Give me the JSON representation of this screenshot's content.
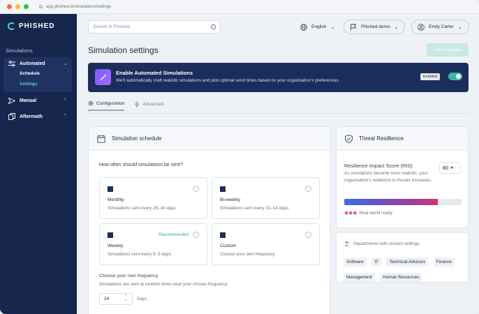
{
  "browser": {
    "url": "app.phished.io/simulations/settings"
  },
  "sidebar": {
    "brand": "PHISHED",
    "section": "Simulations",
    "items": [
      {
        "label": "Automated",
        "icon": "sliders-icon",
        "expanded": true,
        "sub": [
          "Schedule",
          "Settings"
        ],
        "active_sub": "Settings"
      },
      {
        "label": "Manual",
        "icon": "send-icon"
      },
      {
        "label": "Aftermath",
        "icon": "copy-icon"
      }
    ]
  },
  "header": {
    "search_placeholder": "Search in Phished",
    "language": "English",
    "org": "Phished demo",
    "user": "Emily Carter"
  },
  "page": {
    "title": "Simulation settings",
    "save_label": "Save changes"
  },
  "banner": {
    "title": "Enable Automated Simulations",
    "description": "We'll automatically craft realistic simulations and pick optimal send times based on your organisation's preferences.",
    "status": "Enabled",
    "enabled": true
  },
  "tabs": [
    {
      "label": "Configuration",
      "active": true
    },
    {
      "label": "Advanced",
      "active": false
    }
  ],
  "schedule": {
    "title": "Simulation schedule",
    "question": "How often should simulations be sent?",
    "options": [
      {
        "title": "Monthly",
        "desc": "Simulations sent every 26–34 days.",
        "badge": ""
      },
      {
        "title": "Bi-weekly",
        "desc": "Simulations sent every 10–14 days.",
        "badge": ""
      },
      {
        "title": "Weekly",
        "desc": "Simulations sent every 5–9 days.",
        "badge": "Recommended"
      },
      {
        "title": "Custom",
        "desc": "Choose your own frequency",
        "badge": ""
      }
    ],
    "frequency_label": "Choose your own frequency",
    "frequency_hint": "Simulations are sent at random times near your chosen frequency",
    "frequency_value": "24",
    "frequency_unit": "Days"
  },
  "resilience": {
    "title": "Threat Resillience",
    "score_label": "Resilience Impact Score (RIS)",
    "score": "80",
    "description": "As simulations become more realistic, your organisation's resilience to threats increases.",
    "level": 0.8,
    "footer": "Real-world ready"
  },
  "departments": {
    "title": "Departments with custom settings",
    "items": [
      "Software",
      "IT",
      "Technical Advisors",
      "Finance",
      "Management",
      "Human Resources"
    ]
  }
}
